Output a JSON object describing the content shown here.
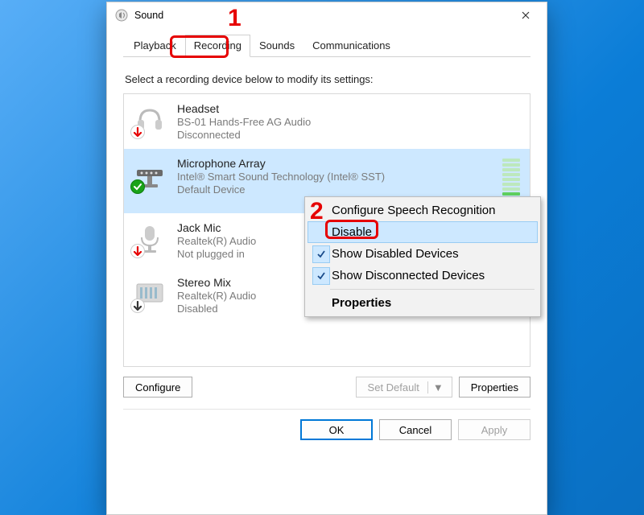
{
  "window": {
    "title": "Sound"
  },
  "tabs": [
    "Playback",
    "Recording",
    "Sounds",
    "Communications"
  ],
  "active_tab": 1,
  "instruction": "Select a recording device below to modify its settings:",
  "devices": [
    {
      "title": "Headset",
      "sub": "BS-01 Hands-Free AG Audio",
      "status": "Disconnected",
      "icon": "headset",
      "overlay": "down-red",
      "selected": false
    },
    {
      "title": "Microphone Array",
      "sub": "Intel® Smart Sound Technology (Intel® SST)",
      "status": "Default Device",
      "icon": "mic-array",
      "overlay": "check-green",
      "selected": true,
      "vu": [
        "#6fdc6f",
        "#6fdc6f",
        "#5fd05f",
        "#bde8bd",
        "#bde8bd",
        "#bde8bd",
        "#bde8bd",
        "#bde8bd",
        "#bde8bd",
        "#bde8bd"
      ]
    },
    {
      "title": "Jack Mic",
      "sub": "Realtek(R) Audio",
      "status": "Not plugged in",
      "icon": "mic",
      "overlay": "down-red",
      "selected": false
    },
    {
      "title": "Stereo Mix",
      "sub": "Realtek(R) Audio",
      "status": "Disabled",
      "icon": "mixer",
      "overlay": "down-black",
      "selected": false
    }
  ],
  "buttons": {
    "configure": "Configure",
    "set_default": "Set Default",
    "properties": "Properties"
  },
  "actions": {
    "ok": "OK",
    "cancel": "Cancel",
    "apply": "Apply"
  },
  "context_menu": {
    "items": [
      {
        "label": "Configure Speech Recognition",
        "checked": false
      },
      {
        "label": "Disable",
        "checked": false,
        "hover": true
      },
      {
        "label": "Show Disabled Devices",
        "checked": true
      },
      {
        "label": "Show Disconnected Devices",
        "checked": true
      },
      {
        "label": "Properties",
        "bold": true
      }
    ]
  },
  "annotations": {
    "one": "1",
    "two": "2"
  }
}
